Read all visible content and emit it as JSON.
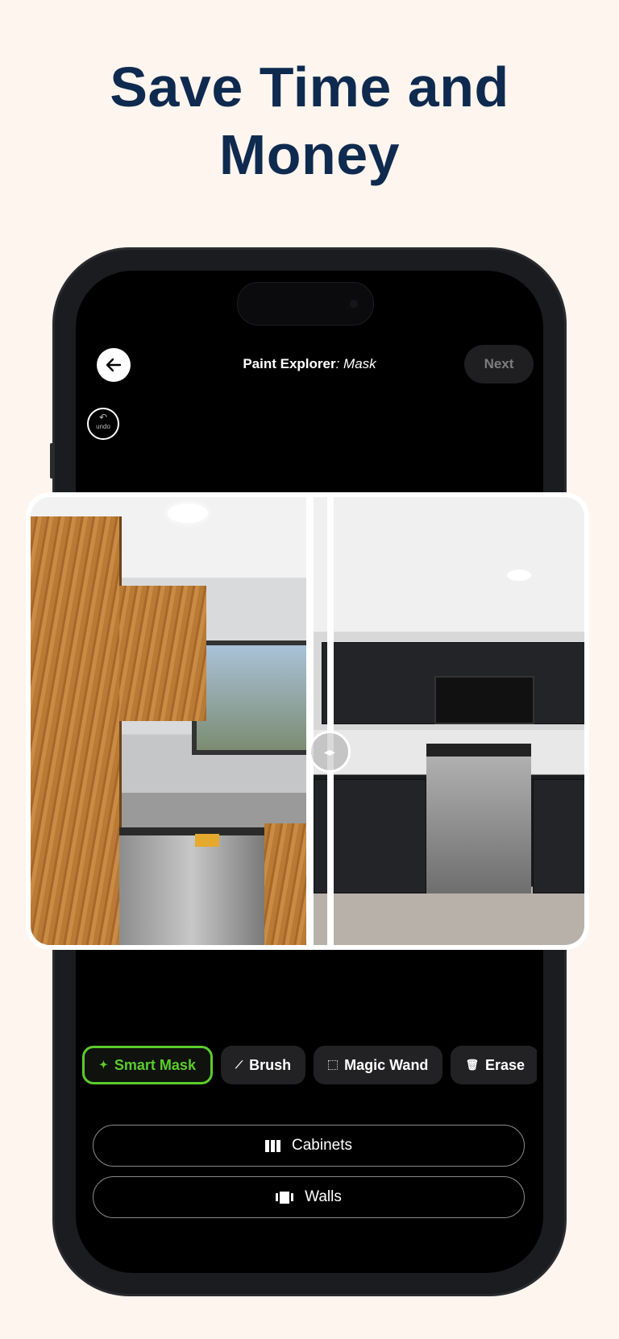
{
  "headline": {
    "line1": "Save Time and",
    "line2": "Money"
  },
  "app": {
    "title": "Paint Explorer",
    "mode": ": Mask",
    "next_label": "Next",
    "undo_label": "undo"
  },
  "tools": [
    {
      "label": "Smart Mask",
      "icon": "sparkle-icon",
      "active": true
    },
    {
      "label": "Brush",
      "icon": "brush-icon",
      "active": false
    },
    {
      "label": "Magic Wand",
      "icon": "selection-icon",
      "active": false
    },
    {
      "label": "Erase",
      "icon": "trash-icon",
      "active": false
    }
  ],
  "categories": [
    {
      "label": "Cabinets",
      "icon": "cabinets-icon"
    },
    {
      "label": "Walls",
      "icon": "walls-icon"
    }
  ],
  "colors": {
    "background": "#fdf5ee",
    "headline": "#0f2a4f",
    "accent": "#5bcc2c"
  }
}
